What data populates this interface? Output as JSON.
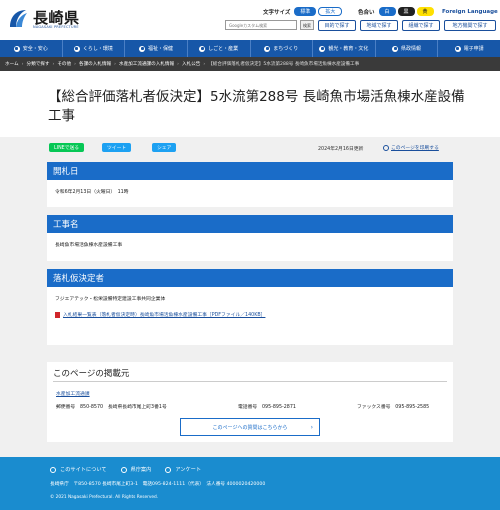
{
  "header": {
    "logo_text": "長崎県",
    "logo_sub": "NAGASAKI PREFECTURE",
    "font_size_label": "文字サイズ",
    "font_standard": "標準",
    "font_large": "拡大",
    "color_label": "色合い",
    "color_white": "白",
    "color_black": "黒",
    "color_yellow": "黄",
    "foreign_language": "Foreign Language",
    "search_placeholder": "Googleカスタム検索",
    "search_button": "検索",
    "nav_purpose": "目的で探す",
    "nav_area": "地域で探す",
    "nav_org": "組織で探す",
    "nav_local": "地方機関で探す"
  },
  "main_nav": [
    {
      "label": "安全・安心"
    },
    {
      "label": "くらし・環境"
    },
    {
      "label": "福祉・保健"
    },
    {
      "label": "しごと・産業"
    },
    {
      "label": "まちづくり"
    },
    {
      "label": "観光・教育・文化"
    },
    {
      "label": "県政情報"
    },
    {
      "label": "電子申請"
    }
  ],
  "breadcrumb": {
    "items": [
      "ホーム",
      "分類で探す",
      "その他",
      "各課の入札情報",
      "水産加工流通課の入札情報",
      "入札公告"
    ],
    "current": "【総合評価落札者仮決定】5水流第288号 長崎魚市場活魚棟水産設備工事"
  },
  "page": {
    "title": "【総合評価落札者仮決定】5水流第288号 長崎魚市場活魚棟水産設備工事",
    "share_line": "LINEで送る",
    "share_twitter": "ツイート",
    "share_facebook": "シェア",
    "date": "2024年2月16日更新",
    "print": "このページを印刷する"
  },
  "sections": {
    "opening_date": {
      "heading": "開札日",
      "body": "令和6年2月13日（火曜日）　11時"
    },
    "work_name": {
      "heading": "工事名",
      "body": "長崎魚市場活魚棟水産設備工事"
    },
    "winner": {
      "heading": "落札仮決定者",
      "body": "フジエアテック・松栄設備特定建設工事共同企業体",
      "pdf_link": "入札結果一覧表（落札者仮決定時）長崎魚市場活魚棟水産設備工事［PDFファイル／140KB］"
    }
  },
  "contact": {
    "title": "このページの掲載元",
    "department": "水産加工流通課",
    "postal": "郵便番号　850-8570　長崎県長崎市尾上町3番1号",
    "phone": "電話番号　095-895-2871",
    "fax": "ファックス番号　095-895-2585",
    "inquiry_button": "このページへの質問はこちらから"
  },
  "footer": {
    "about": "このサイトについて",
    "office_guide": "県庁案内",
    "survey": "アンケート",
    "address": "長崎県庁　〒850-8570 長崎市尾上町3-1　電話095-824-1111（代表）　法人番号 4000020420000",
    "copyright": "© 2021 Nagasaki Prefectural. All Rights Reserved."
  },
  "colors": {
    "brand_blue": "#1757a8",
    "section_blue": "#1a6cc8",
    "footer_blue": "#1a8ccf",
    "line_green": "#06c755",
    "twitter_blue": "#1da1f2",
    "highlight_yellow": "#ffe000"
  }
}
